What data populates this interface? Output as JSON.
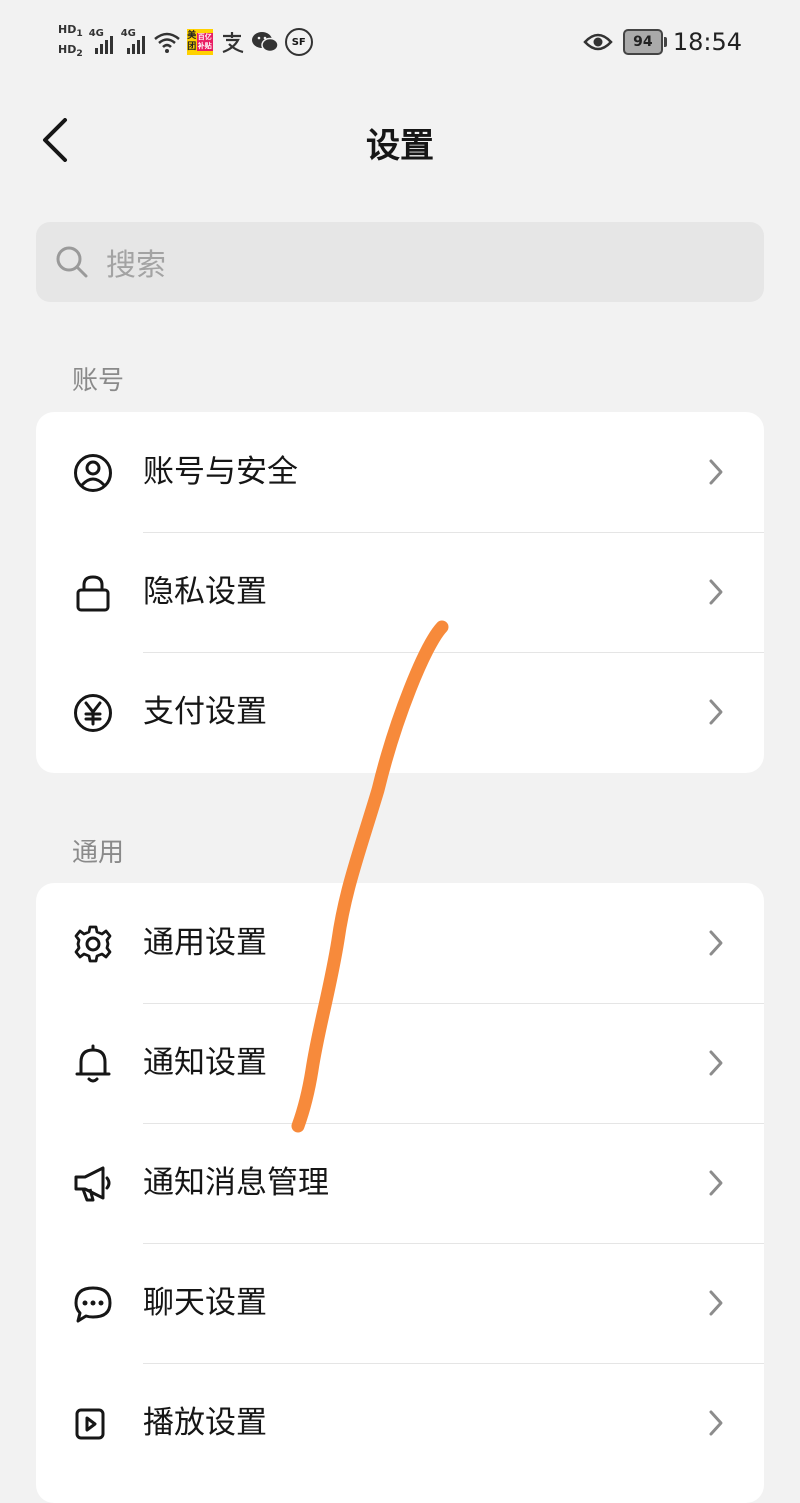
{
  "status_bar": {
    "hd1": "HD",
    "hd1_sub": "1",
    "hd2": "HD",
    "hd2_sub": "2",
    "net1": "4G",
    "net2": "4G",
    "meituan_top": "美团",
    "meituan_bottom": "百亿补贴",
    "sf_label": "SF",
    "battery": "94",
    "time": "18:54"
  },
  "header": {
    "title": "设置"
  },
  "search": {
    "placeholder": "搜索"
  },
  "sections": [
    {
      "label": "账号",
      "items": [
        {
          "label": "账号与安全",
          "icon": "user-circle-icon"
        },
        {
          "label": "隐私设置",
          "icon": "lock-icon"
        },
        {
          "label": "支付设置",
          "icon": "yen-icon"
        }
      ]
    },
    {
      "label": "通用",
      "items": [
        {
          "label": "通用设置",
          "icon": "gear-icon"
        },
        {
          "label": "通知设置",
          "icon": "bell-icon"
        },
        {
          "label": "通知消息管理",
          "icon": "megaphone-icon"
        },
        {
          "label": "聊天设置",
          "icon": "chat-bubble-icon"
        },
        {
          "label": "播放设置",
          "icon": "play-settings-icon"
        }
      ]
    }
  ],
  "colors": {
    "background": "#f2f2f2",
    "card": "#ffffff",
    "search_bg": "#e6e6e6",
    "section_label": "#8a8a8a",
    "annotation_stroke": "#f78a3b"
  }
}
